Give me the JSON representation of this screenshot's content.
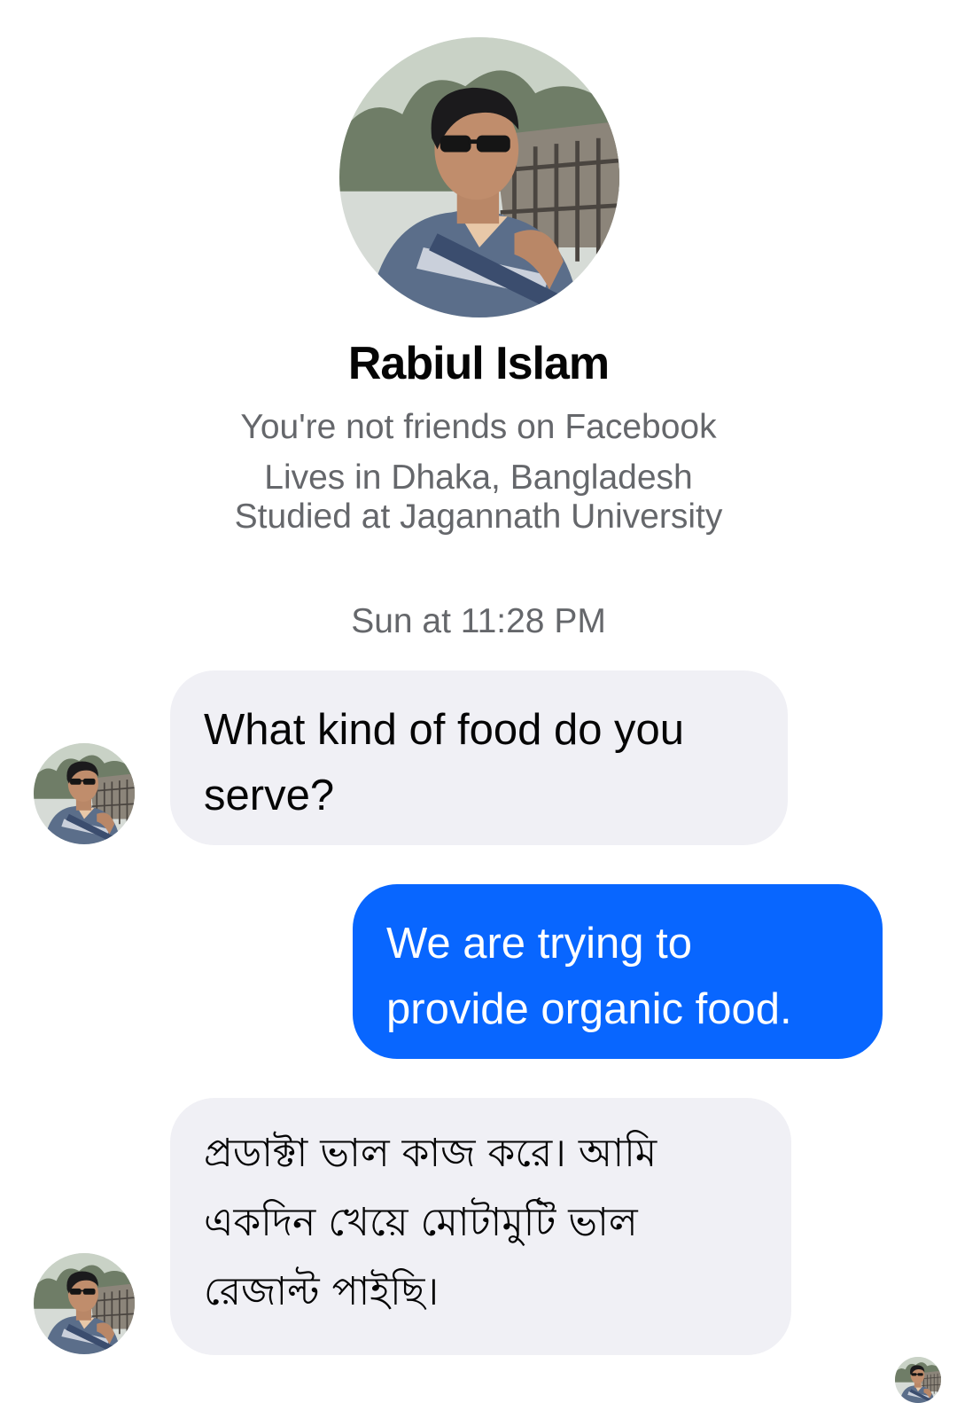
{
  "profile": {
    "name": "Rabiul Islam",
    "friend_status": "You're not friends on Facebook",
    "location": "Lives in Dhaka, Bangladesh",
    "education": "Studied at Jagannath University",
    "photo_icon": "profile-photo"
  },
  "conversation": {
    "timestamp": "Sun at 11:28 PM",
    "messages": [
      {
        "direction": "incoming",
        "lines": [
          "What kind of food do you",
          "serve?"
        ]
      },
      {
        "direction": "outgoing",
        "lines": [
          "We are trying to",
          "provide organic food."
        ]
      },
      {
        "direction": "incoming",
        "lines": [
          "প্রডাক্টা ভাল কাজ করে। আমি",
          "একদিন খেয়ে মোটামুটি ভাল",
          "রেজাল্ট পাইছি।"
        ]
      }
    ]
  },
  "colors": {
    "incoming_bubble": "#f0f0f5",
    "outgoing_bubble": "#0866ff",
    "secondary_text": "#65676b",
    "primary_text": "#050505"
  }
}
